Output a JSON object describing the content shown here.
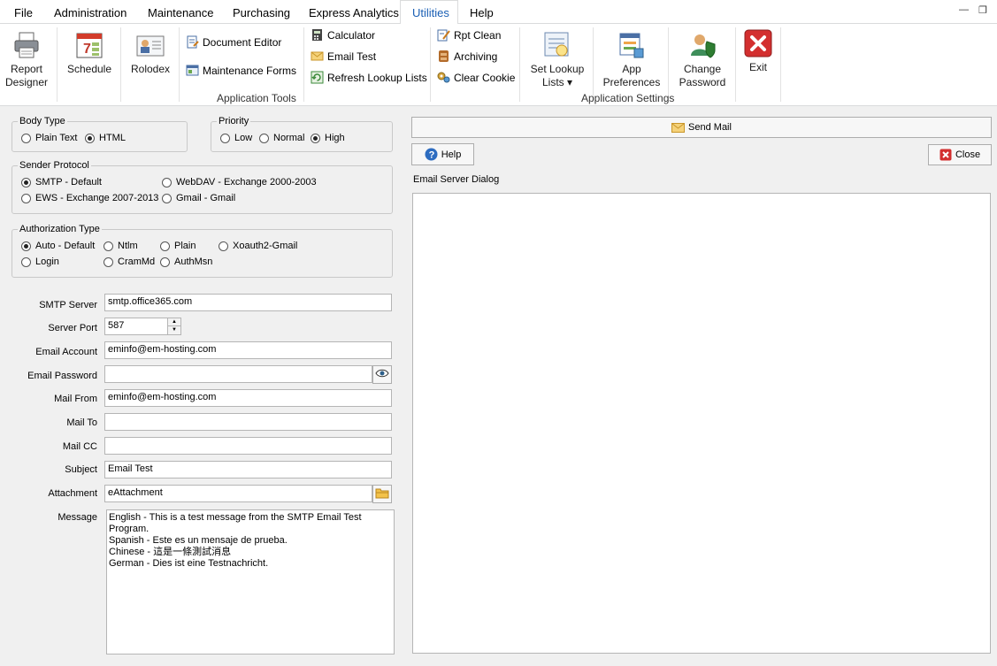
{
  "menu": {
    "items": [
      "File",
      "Administration",
      "Maintenance",
      "Purchasing",
      "Express Analytics",
      "Utilities",
      "Help"
    ],
    "active": "Utilities"
  },
  "ribbon": {
    "report_designer": "Report\nDesigner",
    "schedule": "Schedule",
    "rolodex": "Rolodex",
    "document_editor": "Document Editor",
    "maintenance_forms": "Maintenance Forms",
    "calculator": "Calculator",
    "email_test": "Email Test",
    "refresh_lookup_lists": "Refresh Lookup Lists",
    "rpt_clean": "Rpt Clean",
    "archiving": "Archiving",
    "clear_cookie": "Clear Cookie",
    "set_lookup_lists": "Set Lookup\nLists ▾",
    "app_preferences": "App\nPreferences",
    "change_password": "Change\nPassword",
    "exit": "Exit",
    "group_tools": "Application Tools",
    "group_settings": "Application Settings"
  },
  "body_type": {
    "legend": "Body Type",
    "plain": "Plain Text",
    "html": "HTML",
    "selected": "html"
  },
  "priority": {
    "legend": "Priority",
    "low": "Low",
    "normal": "Normal",
    "high": "High",
    "selected": "high"
  },
  "sender_protocol": {
    "legend": "Sender Protocol",
    "smtp": "SMTP - Default",
    "webdav": "WebDAV - Exchange 2000-2003",
    "ews": "EWS - Exchange 2007-2013",
    "gmail": "Gmail - Gmail",
    "selected": "smtp"
  },
  "auth_type": {
    "legend": "Authorization Type",
    "auto": "Auto - Default",
    "ntlm": "Ntlm",
    "plain": "Plain",
    "xoauth2": "Xoauth2-Gmail",
    "login": "Login",
    "crammd": "CramMd",
    "authmsn": "AuthMsn",
    "selected": "auto"
  },
  "form": {
    "smtp_server_label": "SMTP Server",
    "smtp_server": "smtp.office365.com",
    "server_port_label": "Server Port",
    "server_port": "587",
    "email_account_label": "Email Account",
    "email_account": "eminfo@em-hosting.com",
    "email_password_label": "Email Password",
    "email_password": "",
    "mail_from_label": "Mail From",
    "mail_from": "eminfo@em-hosting.com",
    "mail_to_label": "Mail To",
    "mail_to": "",
    "mail_cc_label": "Mail CC",
    "mail_cc": "",
    "subject_label": "Subject",
    "subject": "Email Test",
    "attachment_label": "Attachment",
    "attachment": "eAttachment",
    "message_label": "Message",
    "message": "English - This is a test message from the SMTP Email Test\nProgram.\nSpanish - Este es un mensaje de prueba.\nChinese - 這是一條測試消息\nGerman - Dies ist eine Testnachricht."
  },
  "right": {
    "send_mail": "Send Mail",
    "help": "Help",
    "close": "Close",
    "dialog_title": "Email Server Dialog"
  }
}
